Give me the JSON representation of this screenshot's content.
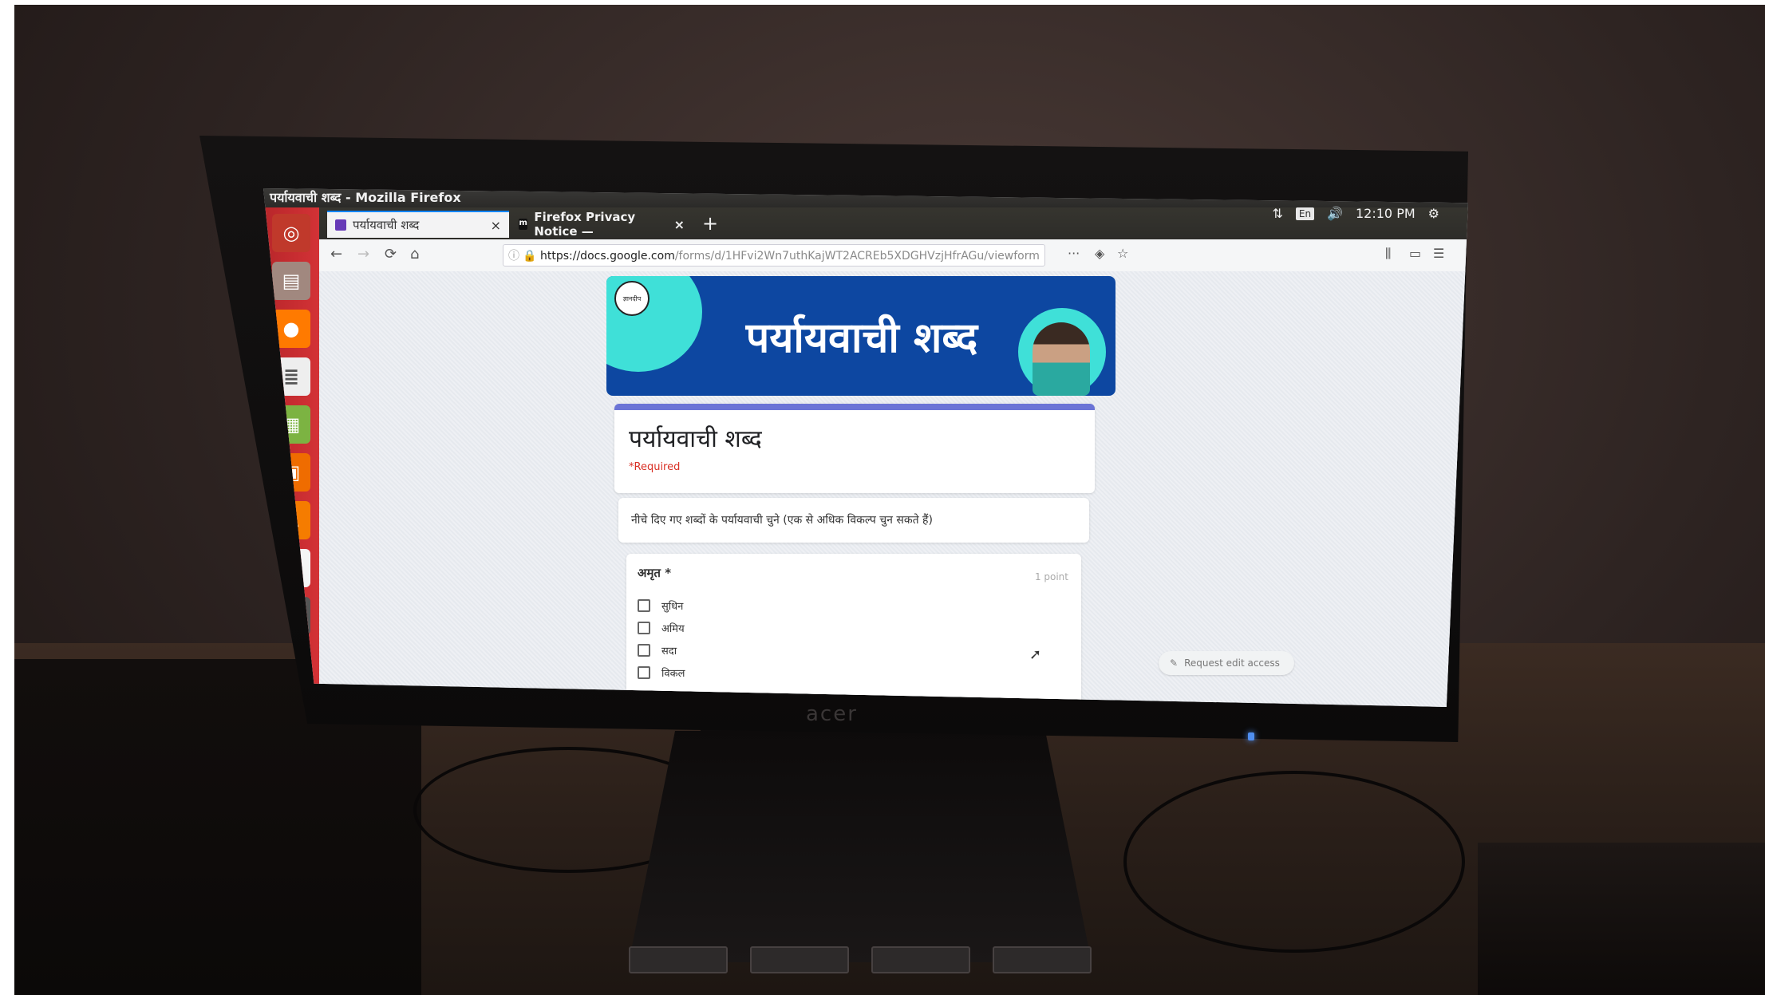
{
  "window": {
    "title": "पर्यायवाची शब्द - Mozilla Firefox"
  },
  "system_tray": {
    "language": "En",
    "time": "12:10 PM"
  },
  "tabs": [
    {
      "label": "पर्यायवाची शब्द",
      "favicon_color": "#673ab7",
      "active": true
    },
    {
      "label": "Firefox Privacy Notice —",
      "favicon_color": "#111111",
      "active": false
    }
  ],
  "url": {
    "host": "https://docs.google.com",
    "path": "/forms/d/1HFvi2Wn7uthKajWT2ACREb5XDGHVzjHfrAGu/viewform"
  },
  "launcher": [
    "ubuntu-logo",
    "files",
    "firefox",
    "writer",
    "calc",
    "impress",
    "software-center",
    "amazon",
    "system-settings",
    "trash"
  ],
  "banner": {
    "title": "पर्यायवाची शब्द",
    "logo_text": "ज्ञानदीप"
  },
  "form": {
    "title": "पर्यायवाची शब्द",
    "required_note": "*Required",
    "description": "नीचे दिए गए शब्दों के पर्यायवाची चुने (एक से अधिक विकल्प चुन सकते हैं)",
    "question": {
      "label": "अमृत *",
      "points": "1 point",
      "options": [
        "सुधिन",
        "अमिय",
        "सदा",
        "विकल"
      ]
    }
  },
  "request_edit_access": "Request edit access",
  "monitor_brand": "acer",
  "colors": {
    "banner_bg": "#0d47a1",
    "accent_teal": "#3fe0d8",
    "form_accent": "#6b74d6",
    "launcher_red": "#d33236"
  }
}
